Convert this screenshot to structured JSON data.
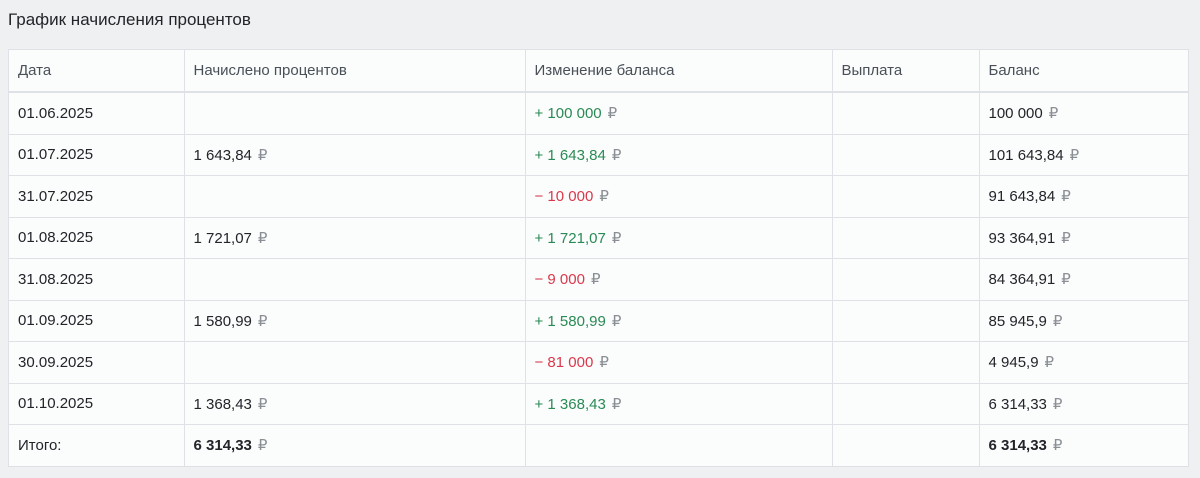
{
  "title": "График начисления процентов",
  "currency_symbol": "₽",
  "columns": [
    "Дата",
    "Начислено процентов",
    "Изменение баланса",
    "Выплата",
    "Баланс"
  ],
  "rows": [
    {
      "date": "01.06.2025",
      "interest": "",
      "change": "+ 100 000",
      "change_type": "positive",
      "payout": "",
      "balance": "100 000"
    },
    {
      "date": "01.07.2025",
      "interest": "1 643,84",
      "change": "+ 1 643,84",
      "change_type": "positive",
      "payout": "",
      "balance": "101 643,84"
    },
    {
      "date": "31.07.2025",
      "interest": "",
      "change": "− 10 000",
      "change_type": "negative",
      "payout": "",
      "balance": "91 643,84"
    },
    {
      "date": "01.08.2025",
      "interest": "1 721,07",
      "change": "+ 1 721,07",
      "change_type": "positive",
      "payout": "",
      "balance": "93 364,91"
    },
    {
      "date": "31.08.2025",
      "interest": "",
      "change": "− 9 000",
      "change_type": "negative",
      "payout": "",
      "balance": "84 364,91"
    },
    {
      "date": "01.09.2025",
      "interest": "1 580,99",
      "change": "+ 1 580,99",
      "change_type": "positive",
      "payout": "",
      "balance": "85 945,9"
    },
    {
      "date": "30.09.2025",
      "interest": "",
      "change": "− 81 000",
      "change_type": "negative",
      "payout": "",
      "balance": "4 945,9"
    },
    {
      "date": "01.10.2025",
      "interest": "1 368,43",
      "change": "+ 1 368,43",
      "change_type": "positive",
      "payout": "",
      "balance": "6 314,33"
    }
  ],
  "totals": {
    "label": "Итого:",
    "interest": "6 314,33",
    "balance": "6 314,33"
  },
  "colors": {
    "positive": "#2a8a55",
    "negative": "#d9394c",
    "currency": "#8a8f95"
  }
}
